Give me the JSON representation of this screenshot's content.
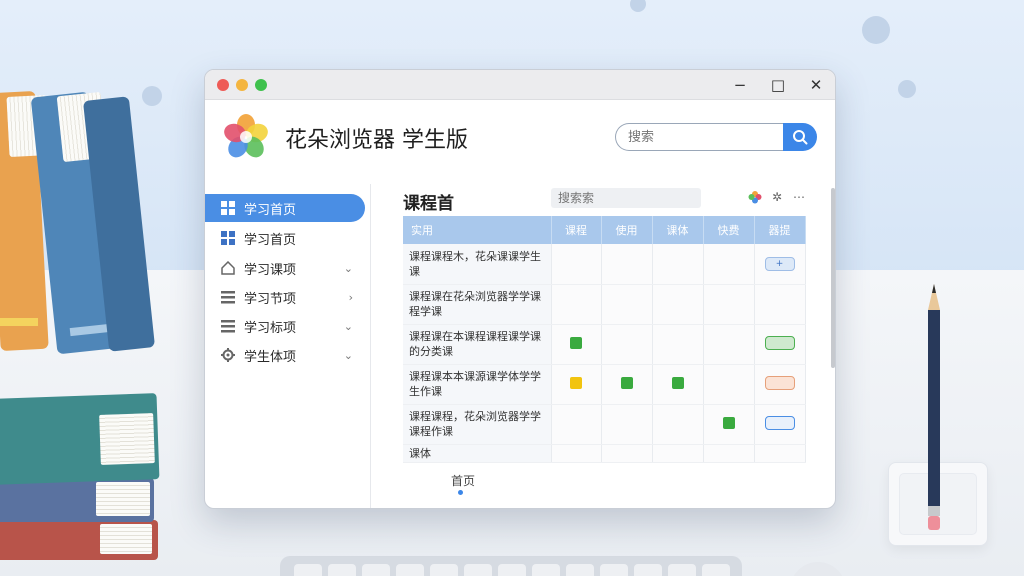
{
  "window": {
    "title": "花朵浏览器 学生版",
    "controls": {
      "minimize": "−",
      "maximize": "□",
      "close": "✕"
    }
  },
  "search": {
    "placeholder": "搜索",
    "icon": "search-icon"
  },
  "sidebar": {
    "items": [
      {
        "label": "学习首页",
        "icon": "grid-icon",
        "active": true,
        "chevron": ""
      },
      {
        "label": "学习首页",
        "icon": "grid-icon",
        "active": false,
        "chevron": ""
      },
      {
        "label": "学习课项",
        "icon": "home-icon",
        "active": false,
        "chevron": "⌄"
      },
      {
        "label": "学习节项",
        "icon": "list-icon",
        "active": false,
        "chevron": "›"
      },
      {
        "label": "学习标项",
        "icon": "list-icon",
        "active": false,
        "chevron": "⌄"
      },
      {
        "label": "学生体项",
        "icon": "gear-icon",
        "active": false,
        "chevron": "⌄"
      }
    ]
  },
  "main": {
    "title": "课程首",
    "mini_search": "搜索索",
    "table": {
      "headers": [
        "实用",
        "课程",
        "使用",
        "课体",
        "快费",
        "器提"
      ],
      "rows": [
        "课程课程木，花朵课课学生课",
        "课程课在花朵浏览器学学课程学课",
        "课程课在本课程课程课学课的分类课",
        "课程课本本课源课学体学学生作课",
        "课程课程，花朵浏览器学学课程作课",
        "课体"
      ]
    }
  },
  "footer": {
    "tab": "首页"
  },
  "colors": {
    "accent": "#4a8ee4",
    "header_row": "#a9c8ec",
    "mark_green": "#3aaa3f",
    "mark_yellow": "#f2c40f"
  }
}
